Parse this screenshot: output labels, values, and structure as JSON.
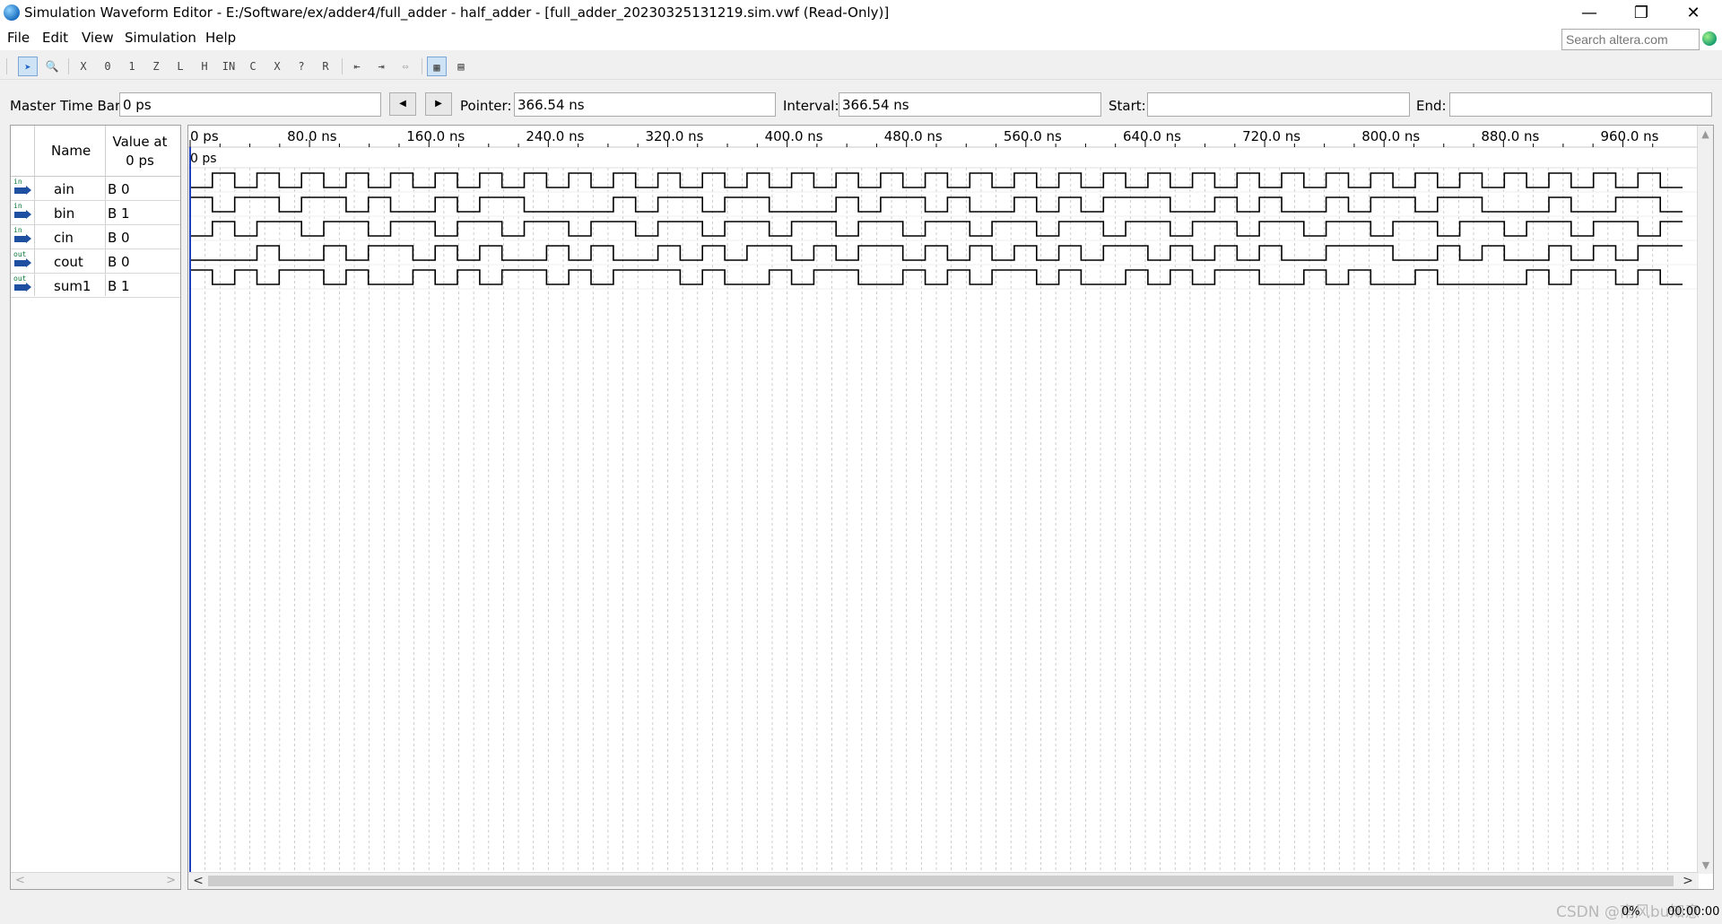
{
  "window": {
    "title": "Simulation Waveform Editor - E:/Software/ex/adder4/full_adder - half_adder - [full_adder_20230325131219.sim.vwf (Read-Only)]",
    "controls": [
      "—",
      "❐",
      "✕"
    ]
  },
  "menu": [
    "File",
    "Edit",
    "View",
    "Simulation",
    "Help"
  ],
  "search": {
    "placeholder": "Search altera.com"
  },
  "toolbar": [
    "selection-tool",
    "zoom-tool",
    "forcing-unknown",
    "forcing-low",
    "forcing-high",
    "high-impedance",
    "weak-unknown",
    "weak-low",
    "weak-high",
    "invert",
    "count-value",
    "clock",
    "arbitrary-value",
    "random-values",
    "snap-to-grid",
    "show-grid",
    "fit-waveform"
  ],
  "timebar": {
    "master_label": "Master Time Bar:",
    "master_value": "0 ps",
    "pointer_label": "Pointer:",
    "pointer_value": "366.54 ns",
    "interval_label": "Interval:",
    "interval_value": "366.54 ns",
    "start_label": "Start:",
    "start_value": "",
    "end_label": "End:",
    "end_value": ""
  },
  "signals_header": {
    "name": "Name",
    "value_at": "Value at",
    "value_time": "0 ps"
  },
  "signals": [
    {
      "direction": "in",
      "name": "ain",
      "value": "B 0",
      "wave": "0101010101010101010101010101010101010101010101010101010101010101010"
    },
    {
      "direction": "in",
      "name": "bin",
      "value": "B 1",
      "wave": "1011011010010110000101101100010110100101011100101001011011000100110"
    },
    {
      "direction": "in",
      "name": "cin",
      "value": "B 0",
      "wave": "0101101101101101101101101101101101101101101101101101101101101101101"
    },
    {
      "direction": "out",
      "name": "cout",
      "value": "B 0",
      "wave": "0001001011010100101001010110101101010101011010101001110010100101011"
    },
    {
      "direction": "out",
      "name": "sum1",
      "value": "B 1",
      "wave": "1010110100101011010111010010110010101101001010110010100100001011010"
    }
  ],
  "ruler": {
    "labels": [
      "0 ps",
      "80.0 ns",
      "160.0 ns",
      "240.0 ns",
      "320.0 ns",
      "400.0 ns",
      "480.0 ns",
      "560.0 ns",
      "640.0 ns",
      "720.0 ns",
      "800.0 ns",
      "880.0 ns",
      "960.0 ns"
    ],
    "marker_label": "0 ps",
    "range_ns": [
      0,
      1000
    ]
  },
  "status": {
    "percent": "0%",
    "elapsed": "00:00:00",
    "watermark": "CSDN @南风bu知意"
  }
}
